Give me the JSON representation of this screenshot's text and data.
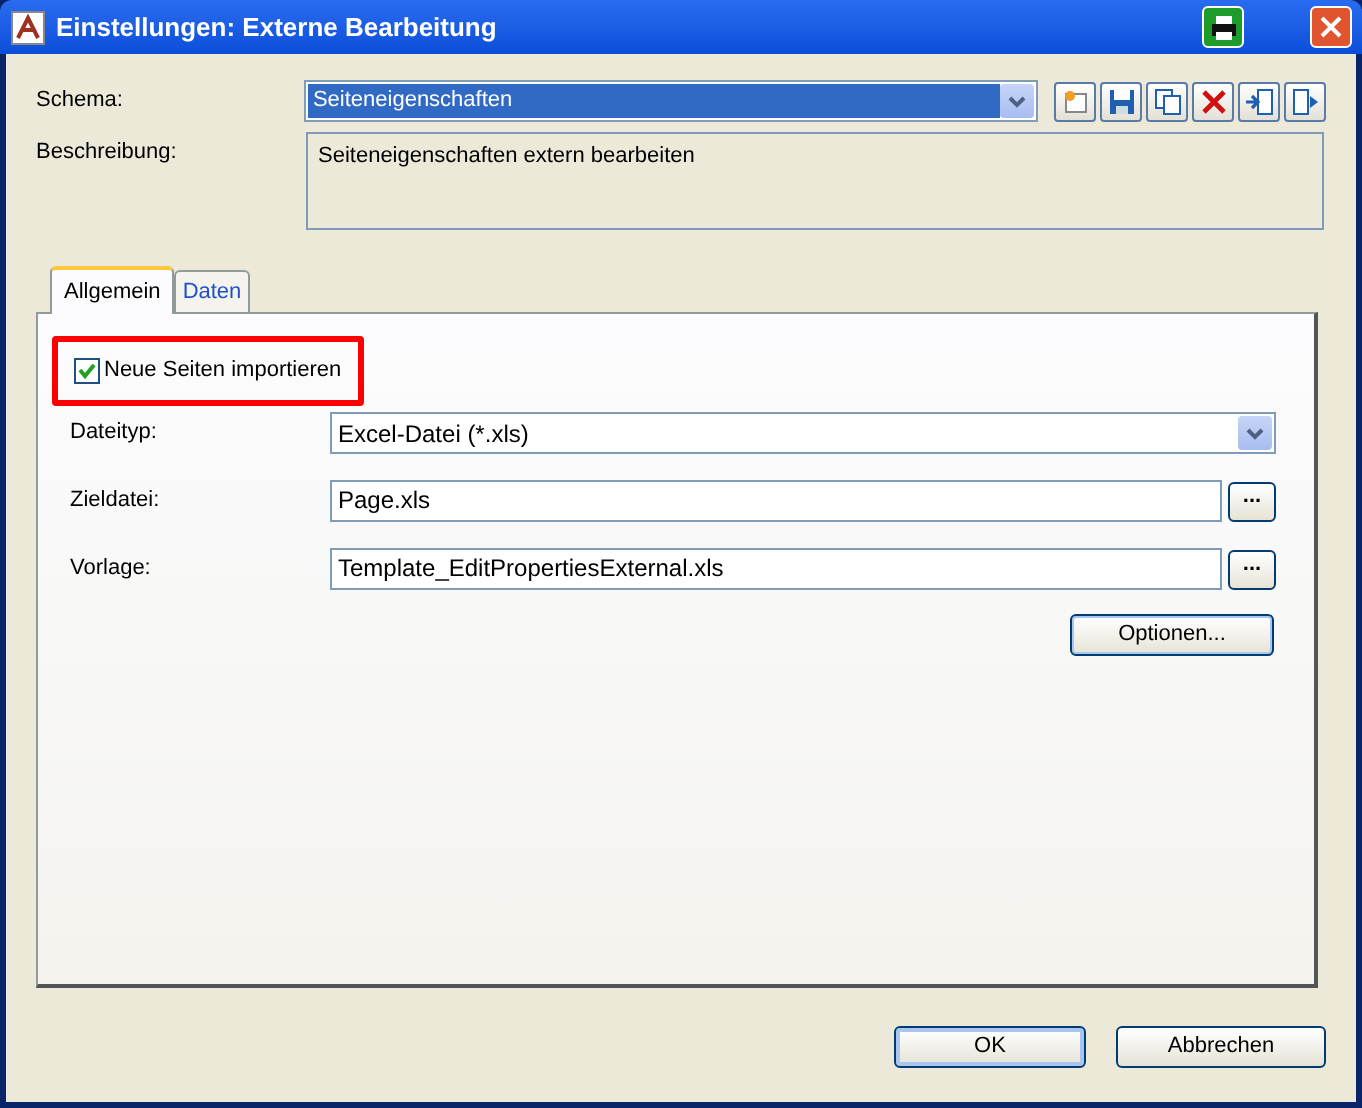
{
  "window": {
    "title": "Einstellungen: Externe Bearbeitung"
  },
  "schema": {
    "label": "Schema:",
    "value": "Seiteneigenschaften",
    "toolbar": [
      {
        "kind": "new"
      },
      {
        "kind": "save"
      },
      {
        "kind": "copy"
      },
      {
        "kind": "delete"
      },
      {
        "kind": "import"
      },
      {
        "kind": "export"
      }
    ]
  },
  "description": {
    "label": "Beschreibung:",
    "value": "Seiteneigenschaften extern bearbeiten"
  },
  "tabs": [
    {
      "label": "Allgemein",
      "selected": true
    },
    {
      "label": "Daten",
      "selected": false
    }
  ],
  "import_checkbox": {
    "label": "Neue Seiten importieren",
    "checked": true,
    "highlighted": true
  },
  "fields": [
    {
      "kind": "dropdown",
      "label": "Dateityp:",
      "value": "Excel-Datei (*.xls)"
    },
    {
      "kind": "file",
      "label": "Zieldatei:",
      "value": "Page.xls",
      "browse": "..."
    },
    {
      "kind": "file",
      "label": "Vorlage:",
      "value": "Template_EditPropertiesExternal.xls",
      "browse": "..."
    }
  ],
  "options_button": "Optionen...",
  "buttons": [
    {
      "label": "OK",
      "selected": true
    },
    {
      "label": "Abbrechen",
      "selected": false
    }
  ]
}
